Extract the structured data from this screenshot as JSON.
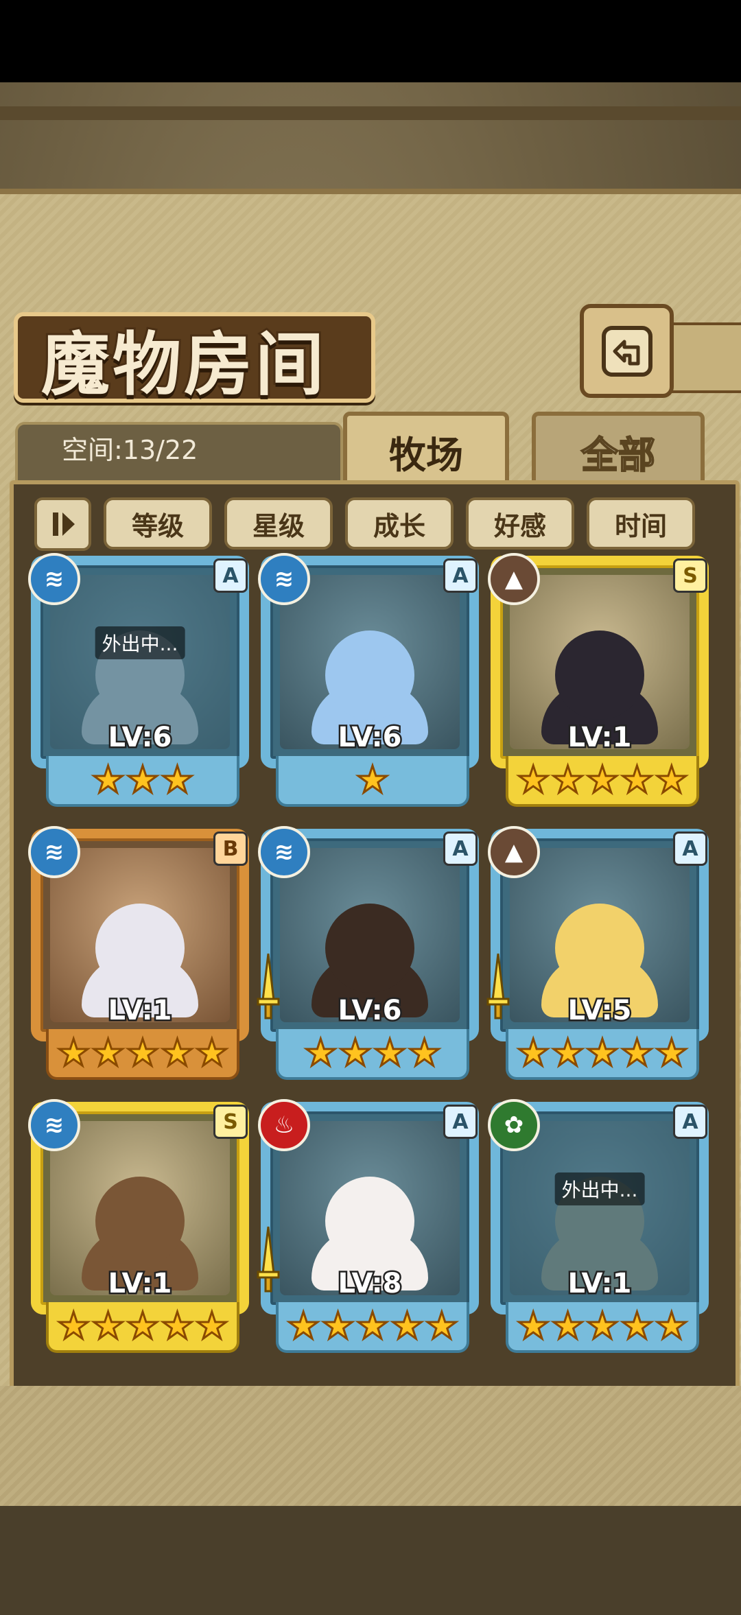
{
  "title": "魔物房间",
  "space": {
    "label": "空间:13/22"
  },
  "tabs": [
    {
      "label": "牧场",
      "active": true
    },
    {
      "label": "全部",
      "active": false
    }
  ],
  "sort": {
    "toggle_icon": "sort-order-icon",
    "buttons": [
      "等级",
      "星级",
      "成长",
      "好感",
      "时间"
    ]
  },
  "away_text": "外出中...",
  "element_colors": {
    "water": "#2f7fc0",
    "earth": "#6a4a35",
    "fire": "#c81e1e",
    "nature": "#2f7a2f"
  },
  "monsters": [
    {
      "element": "water",
      "rank": "A",
      "level": "LV:6",
      "stars": 3,
      "frame": "blue",
      "away": true,
      "sword": false,
      "color": "#b8c6cf"
    },
    {
      "element": "water",
      "rank": "A",
      "level": "LV:6",
      "stars": 1,
      "frame": "blue",
      "away": false,
      "sword": false,
      "color": "#9dc7ef"
    },
    {
      "element": "earth",
      "rank": "S",
      "level": "LV:1",
      "stars": 5,
      "frame": "gold",
      "away": false,
      "sword": false,
      "color": "#2b2630"
    },
    {
      "element": "water",
      "rank": "B",
      "level": "LV:1",
      "stars": 5,
      "frame": "bronze",
      "away": false,
      "sword": false,
      "color": "#e8e6ee"
    },
    {
      "element": "water",
      "rank": "A",
      "level": "LV:6",
      "stars": 4,
      "frame": "blue",
      "away": false,
      "sword": true,
      "color": "#3b2b22"
    },
    {
      "element": "earth",
      "rank": "A",
      "level": "LV:5",
      "stars": 5,
      "frame": "blue",
      "away": false,
      "sword": true,
      "color": "#f2d16a"
    },
    {
      "element": "water",
      "rank": "S",
      "level": "LV:1",
      "stars": 5,
      "frame": "gold",
      "away": false,
      "sword": false,
      "color": "#7a5636"
    },
    {
      "element": "fire",
      "rank": "A",
      "level": "LV:8",
      "stars": 5,
      "frame": "blue",
      "away": false,
      "sword": true,
      "color": "#f4f0ee"
    },
    {
      "element": "nature",
      "rank": "A",
      "level": "LV:1",
      "stars": 5,
      "frame": "blue",
      "away": true,
      "sword": false,
      "color": "#8b8f7a"
    }
  ]
}
